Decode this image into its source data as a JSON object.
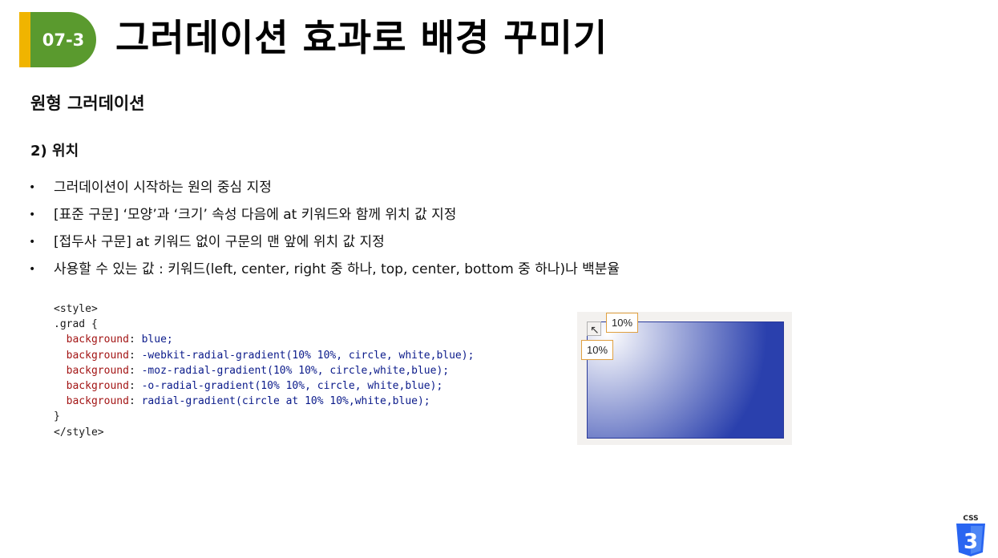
{
  "header": {
    "chapter_badge": "07-3",
    "title": "그러데이션 효과로 배경 꾸미기"
  },
  "section": {
    "title": "원형 그러데이션",
    "subtitle": "2) 위치"
  },
  "bullets": [
    "그러데이션이 시작하는 원의 중심 지정",
    "[표준 구문] ‘모양’과 ‘크기’ 속성 다음에 at 키워드와 함께 위치 값 지정",
    "[접두사 구문] at 키워드 없이 구문의 맨 앞에 위치 값 지정",
    "사용할 수 있는 값 : 키워드(left, center, right 중 하나, top, center, bottom 중 하나)나 백분율"
  ],
  "bullet_marker": "•",
  "code": {
    "open_tag": "<style>",
    "selector": ".grad {",
    "lines": [
      {
        "prop": "background",
        "value": "blue;"
      },
      {
        "prop": "background",
        "value": "-webkit-radial-gradient(10% 10%, circle, white,blue);"
      },
      {
        "prop": "background",
        "value": "-moz-radial-gradient(10% 10%, circle,white,blue);"
      },
      {
        "prop": "background",
        "value": "-o-radial-gradient(10% 10%, circle, white,blue);"
      },
      {
        "prop": "background",
        "value": "radial-gradient(circle at 10% 10%,white,blue);"
      }
    ],
    "close_brace": "}",
    "close_tag": "</style>"
  },
  "demo": {
    "label_top": "10%",
    "label_left": "10%",
    "gradient_start": "#ffffff",
    "gradient_end": "#2a40ad"
  },
  "logo": {
    "caption": "CSS",
    "number": "3",
    "icon": "css3-shield-icon",
    "color": "#2965f1"
  },
  "colors": {
    "badge_green": "#5a9a2e",
    "badge_stripe": "#f0b400"
  }
}
